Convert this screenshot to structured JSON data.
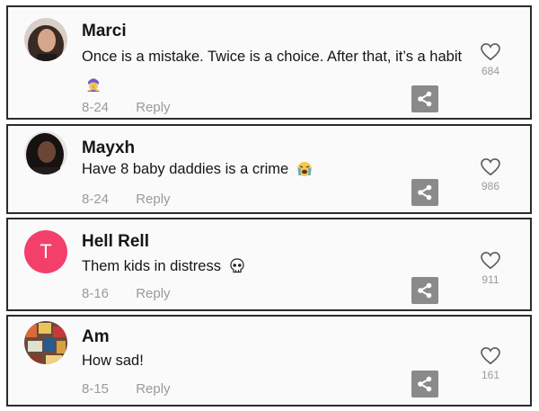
{
  "comments": [
    {
      "username": "Marci",
      "text": "Once is a mistake. Twice is a choice. After that, it’s a habit",
      "emoji": "woman-gesturing-no",
      "date": "8-24",
      "reply": "Reply",
      "likes": "684",
      "avatar": "photo"
    },
    {
      "username": "Mayxh",
      "text": "Have 8 baby daddies is a crime",
      "emoji": "loudly-crying-face",
      "date": "8-24",
      "reply": "Reply",
      "likes": "986",
      "avatar": "photo"
    },
    {
      "username": "Hell Rell",
      "text": "Them kids in distress",
      "emoji": "skull",
      "date": "8-16",
      "reply": "Reply",
      "likes": "911",
      "avatar": "T",
      "avatar_color": "#f2406b"
    },
    {
      "username": "Am",
      "text": "How sad!",
      "emoji": "",
      "date": "8-15",
      "reply": "Reply",
      "likes": "161",
      "avatar": "photo"
    }
  ]
}
